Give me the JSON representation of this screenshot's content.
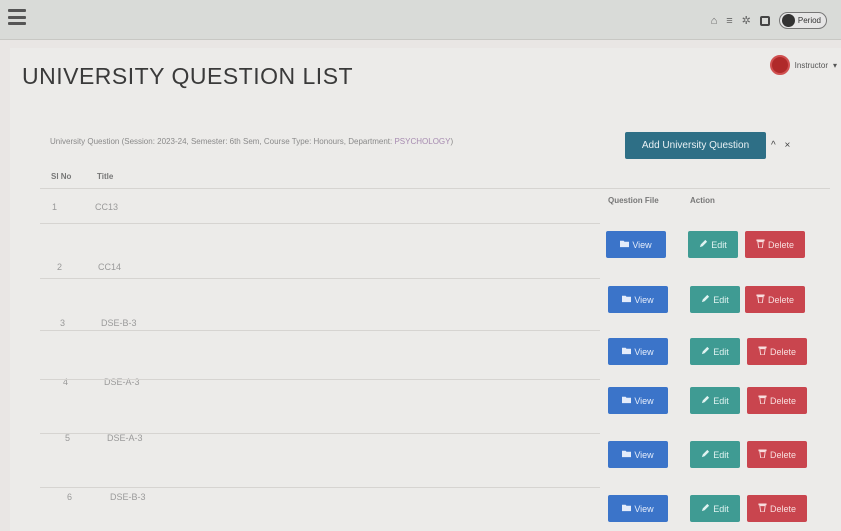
{
  "page": {
    "title": "UNIVERSITY QUESTION LIST",
    "info_prefix": "University Question (Session: 2023-24, Semester: 6th Sem, Course Type: Honours, Department: ",
    "info_dept": "PSYCHOLOGY",
    "info_suffix": ")",
    "add_button": "Add University Question",
    "collapse": "^ ×"
  },
  "topbar": {
    "icons": [
      "home-icon",
      "grid-icon",
      "gear-icon",
      "square-icon"
    ],
    "profile_chip": "Period"
  },
  "user_menu": {
    "name": "Instructor"
  },
  "table": {
    "headers": {
      "sl": "Sl No",
      "title": "Title",
      "question_file": "Question File",
      "action": "Action"
    },
    "rows": [
      {
        "sl": "1",
        "title": "CC13",
        "view": "View",
        "edit": "Edit",
        "delete": "Delete"
      },
      {
        "sl": "2",
        "title": "CC14",
        "view": "View",
        "edit": "Edit",
        "delete": "Delete"
      },
      {
        "sl": "3",
        "title": "DSE-B-3",
        "view": "View",
        "edit": "Edit",
        "delete": "Delete"
      },
      {
        "sl": "4",
        "title": "DSE-A-3",
        "view": "View",
        "edit": "Edit",
        "delete": "Delete"
      },
      {
        "sl": "5",
        "title": "DSE-A-3",
        "view": "View",
        "edit": "Edit",
        "delete": "Delete"
      },
      {
        "sl": "6",
        "title": "DSE-B-3",
        "view": "View",
        "edit": "Edit",
        "delete": "Delete"
      }
    ]
  },
  "colors": {
    "add": "#2e6f86",
    "view": "#3b74c9",
    "edit": "#3f9b93",
    "delete": "#c9454e"
  }
}
